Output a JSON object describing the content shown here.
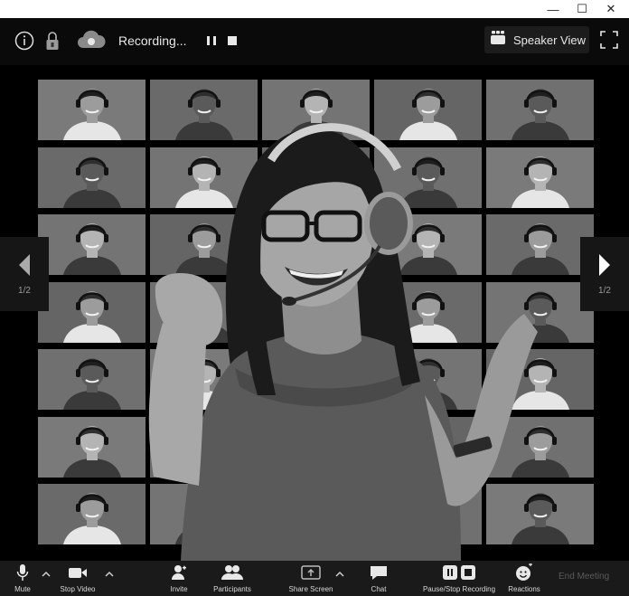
{
  "window": {
    "minimize_glyph": "—",
    "maximize_glyph": "☐",
    "close_glyph": "✕"
  },
  "topbar": {
    "recording_status": "Recording...",
    "view_label": "Speaker View",
    "icons": [
      "info-icon",
      "lock-icon",
      "cloud-record-icon",
      "pause-icon",
      "stop-icon",
      "speaker-view-icon",
      "fullscreen-icon"
    ]
  },
  "gallery": {
    "page_left": "1/2",
    "page_right": "1/2"
  },
  "toolbar": {
    "mute": "Mute",
    "stop_video": "Stop Video",
    "invite": "Invite",
    "participants": "Participants",
    "share_screen": "Share Screen",
    "chat": "Chat",
    "pause_stop_recording": "Pause/Stop Recording",
    "reactions": "Reactions",
    "end_meeting": "End Meeting"
  },
  "colors": {
    "background": "#000000",
    "toolbar": "#1a1a1a",
    "tile": "#6e6e6e",
    "text": "#e8e8e8"
  }
}
